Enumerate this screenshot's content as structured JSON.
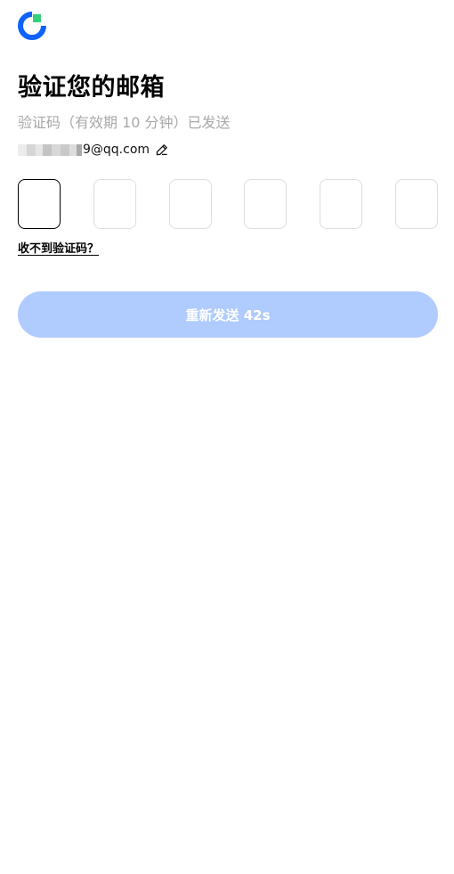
{
  "brand": {
    "logo_icon": "app-logo-icon",
    "primary_color": "#0f62fe",
    "accent_color": "#33d17a"
  },
  "page": {
    "title": "验证您的邮箱",
    "subtitle": "验证码（有效期 10 分钟）已发送"
  },
  "email": {
    "masked_suffix": "9@qq.com",
    "edit_icon": "pencil-icon"
  },
  "code": {
    "digits": [
      "",
      "",
      "",
      "",
      "",
      ""
    ],
    "active_index": 0
  },
  "links": {
    "no_code": "收不到验证码？"
  },
  "resend": {
    "label": "重新发送 42s",
    "disabled_color": "#b0cbfd"
  }
}
